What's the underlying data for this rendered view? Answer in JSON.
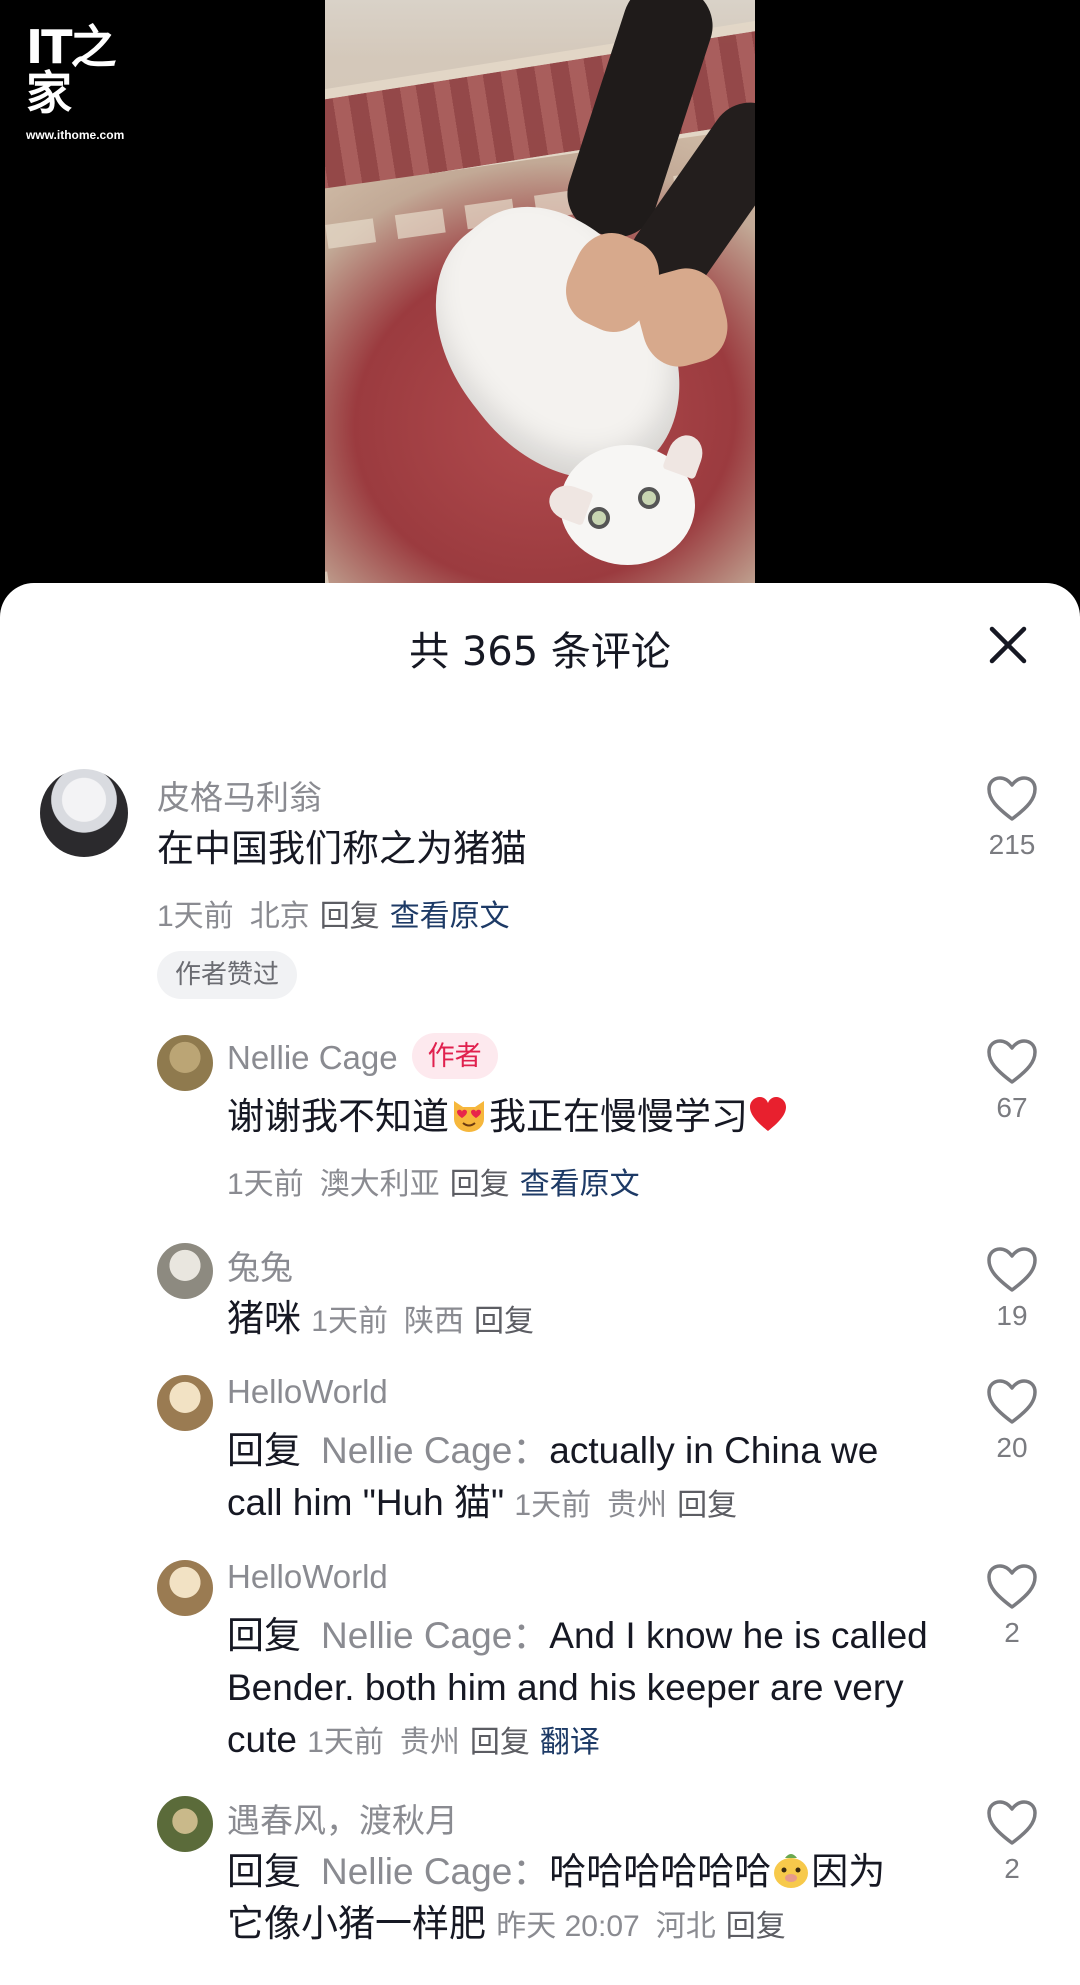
{
  "logo": {
    "mark": "IT之家",
    "url": "www.ithome.com"
  },
  "sheet": {
    "title": "共 365 条评论"
  },
  "comments": [
    {
      "username": "皮格马利翁",
      "text": "在中国我们称之为猪猫",
      "time": "1天前",
      "location": "北京",
      "reply_label": "回复",
      "view_original_label": "查看原文",
      "likes": "215",
      "author_liked_label": "作者赞过"
    },
    {
      "username": "Nellie Cage",
      "author_tag": "作者",
      "text_before_emoji": "谢谢我不知道",
      "text_middle": "我正在慢慢学习",
      "time": "1天前",
      "location": "澳大利亚",
      "reply_label": "回复",
      "view_original_label": "查看原文",
      "likes": "67"
    },
    {
      "username": "兔兔",
      "text": "猪咪",
      "time": "1天前",
      "location": "陕西",
      "reply_label": "回复",
      "likes": "19"
    },
    {
      "username": "HelloWorld",
      "reply_prefix": "回复",
      "reply_to": "Nellie Cage",
      "separator": "：",
      "text_line1": "actually in China we",
      "text_line2": "call him \"Huh 猫\"",
      "time": "1天前",
      "location": "贵州",
      "reply_label": "回复",
      "likes": "20"
    },
    {
      "username": "HelloWorld",
      "reply_prefix": "回复",
      "reply_to": "Nellie Cage",
      "separator": "：",
      "text_line1": "And I know he is called",
      "text_line2": "Bender. both him and his keeper are very",
      "text_line3": "cute",
      "time": "1天前",
      "location": "贵州",
      "reply_label": "回复",
      "translate_label": "翻译",
      "likes": "2"
    },
    {
      "username": "遇春风，渡秋月",
      "reply_prefix": "回复",
      "reply_to": "Nellie Cage",
      "separator": "：",
      "text_before_emoji": "哈哈哈哈哈哈",
      "text_after_emoji": "因为",
      "text_line2": "它像小猪一样肥",
      "time": "昨天 20:07",
      "location": "河北",
      "reply_label": "回复",
      "likes": "2"
    }
  ],
  "colors": {
    "link": "#1d3a66",
    "author_tag_bg": "#fde9ee",
    "author_tag_text": "#e0214e",
    "muted_text": "#8a8b91",
    "primary_text": "#161823"
  },
  "icons": [
    "close-icon",
    "heart-outline-icon",
    "heart-eyes-cat-emoji",
    "red-heart-emoji",
    "smiling-pig-emoji"
  ]
}
